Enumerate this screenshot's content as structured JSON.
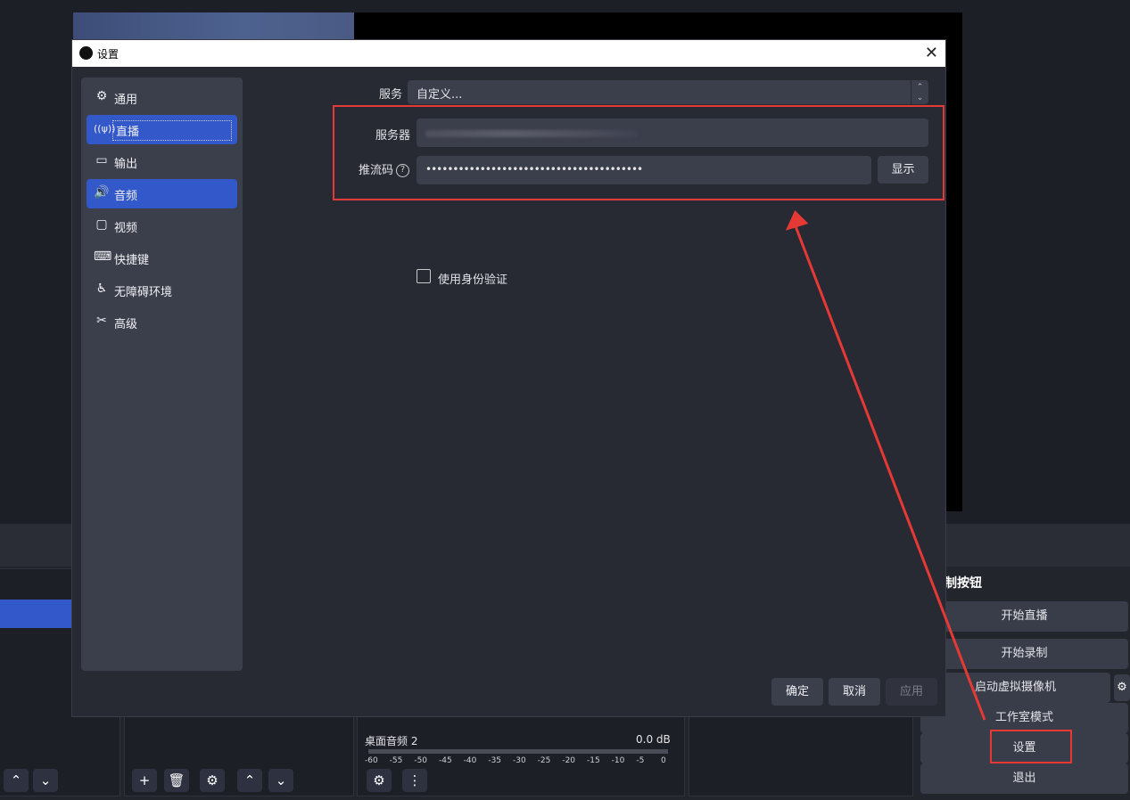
{
  "dialog": {
    "title": "设置",
    "nav": [
      {
        "label": "通用",
        "icon": "gear-icon"
      },
      {
        "label": "直播",
        "icon": "broadcast-icon"
      },
      {
        "label": "输出",
        "icon": "output-icon"
      },
      {
        "label": "音频",
        "icon": "speaker-icon"
      },
      {
        "label": "视频",
        "icon": "monitor-icon"
      },
      {
        "label": "快捷键",
        "icon": "keyboard-icon"
      },
      {
        "label": "无障碍环境",
        "icon": "accessibility-icon"
      },
      {
        "label": "高级",
        "icon": "tools-icon"
      }
    ],
    "service_label": "服务",
    "service_value": "自定义...",
    "server_label": "服务器",
    "stream_key_label": "推流码",
    "stream_key_value": "••••••••••••••••••••••••••••••••••••••••",
    "show_button": "显示",
    "use_auth_label": "使用身份验证",
    "ok_button": "确定",
    "cancel_button": "取消",
    "apply_button": "应用"
  },
  "controls": {
    "title": "制按钮",
    "start_streaming": "开始直播",
    "start_recording": "开始录制",
    "virtual_camera": "启动虚拟摄像机",
    "studio_mode": "工作室模式",
    "settings": "设置",
    "exit": "退出"
  },
  "mixer": {
    "channel_name": "桌面音频 2",
    "level": "0.0 dB",
    "ticks": [
      "-60",
      "-55",
      "-50",
      "-45",
      "-40",
      "-35",
      "-30",
      "-25",
      "-20",
      "-15",
      "-10",
      "-5",
      "0"
    ]
  },
  "colors": {
    "accent": "#3258c9",
    "annotation": "#e53935"
  }
}
